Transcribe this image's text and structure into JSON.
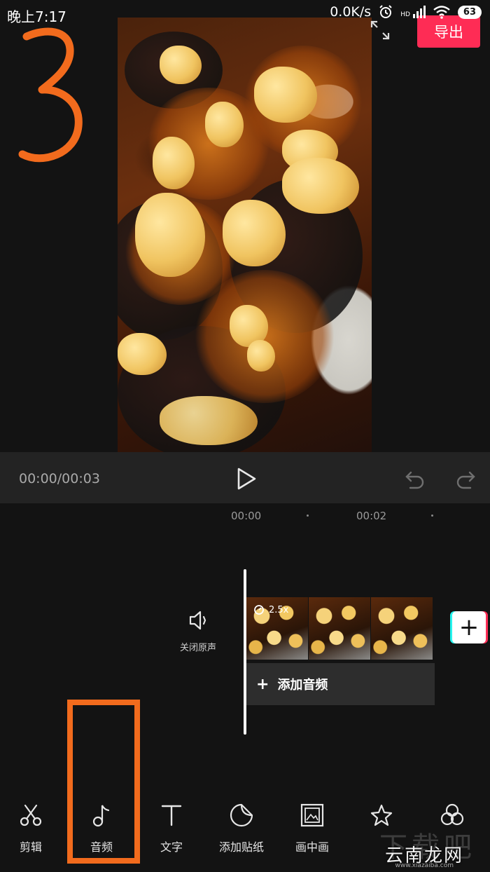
{
  "status_bar": {
    "time": "晚上7:17",
    "net_speed": "0.0K/s",
    "hd_label": "HD",
    "battery": "63"
  },
  "header": {
    "export_label": "导出"
  },
  "annotations": {
    "step_number": "3",
    "highlight_color": "#f26b1d"
  },
  "player": {
    "time_display": "00:00/00:03"
  },
  "timeline": {
    "ticks": [
      "00:00",
      "00:02"
    ],
    "speed_badge": "2.5x",
    "add_audio_label": "添加音频"
  },
  "mute": {
    "label": "关闭原声"
  },
  "toolbar": {
    "items": [
      {
        "label": "剪辑",
        "icon": "scissors-icon"
      },
      {
        "label": "音频",
        "icon": "music-note-icon"
      },
      {
        "label": "文字",
        "icon": "text-icon"
      },
      {
        "label": "添加贴纸",
        "icon": "sticker-icon"
      },
      {
        "label": "画中画",
        "icon": "picture-in-picture-icon"
      },
      {
        "label": "",
        "icon": "effects-star-icon"
      },
      {
        "label": "",
        "icon": "filter-icon"
      }
    ]
  },
  "watermark": {
    "text": "云南龙网",
    "url": "www.xiazaiba.com",
    "bg_text": "下载吧"
  },
  "colors": {
    "accent": "#fe2c55",
    "background": "#131313"
  }
}
